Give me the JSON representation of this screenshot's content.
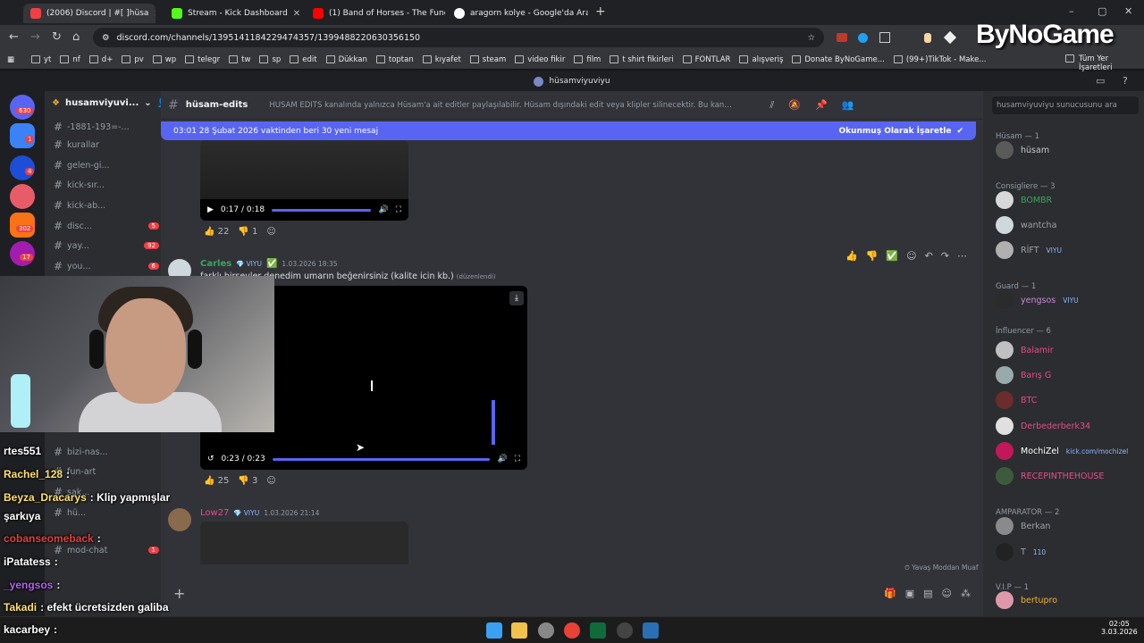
{
  "browser": {
    "tabs": [
      {
        "title": "(2006) Discord | #[ ]hüsa",
        "active": true,
        "color": "#f23f43"
      },
      {
        "title": "Stream - Kick Dashboard",
        "active": false,
        "color": "#53fc18"
      },
      {
        "title": "(1) Band of Horses - The Funer",
        "active": false,
        "color": "#ff0000"
      },
      {
        "title": "aragorn kolye - Google'da Ara",
        "active": false,
        "color": "#ffffff"
      }
    ],
    "url": "discord.com/channels/1395141184229474357/1399488220630356150",
    "bookmarks": [
      "yt",
      "nf",
      "d+",
      "pv",
      "wp",
      "telegr",
      "tw",
      "sp",
      "edit",
      "Dükkan",
      "toptan",
      "kıyafet",
      "steam",
      "video fikir",
      "film",
      "t shirt fikirleri",
      "FONTLAR",
      "alışveriş",
      "Donate ByNoGame...",
      "(99+)TikTok - Make..."
    ],
    "bookmarks_right": "Tüm Yer İşaretleri"
  },
  "logo": "ByNoGame",
  "discord": {
    "window_title": "hüsamviyuviyu",
    "server_name": "husamviyuvi...",
    "guild_badges": [
      "630",
      "1",
      "4",
      "302",
      "17"
    ],
    "channels": [
      {
        "name": "-1881-193=-...",
        "badge": ""
      },
      {
        "name": "kurallar",
        "badge": ""
      },
      {
        "name": "gelen-gi...",
        "badge": ""
      },
      {
        "name": "kick-sır...",
        "badge": ""
      },
      {
        "name": "kick-ab...",
        "badge": ""
      },
      {
        "name": "disc...",
        "badge": "5"
      },
      {
        "name": "yay...",
        "badge": "92"
      },
      {
        "name": "you...",
        "badge": "6"
      },
      {
        "name": "bizi-nas...",
        "badge": ""
      },
      {
        "name": "fun-art",
        "badge": ""
      },
      {
        "name": "sak...",
        "badge": ""
      },
      {
        "name": "hü...",
        "badge": ""
      },
      {
        "name": "mod-chat",
        "badge": "1"
      }
    ],
    "channel_header": {
      "name": "hüsam-edits",
      "topic": "HÜSAM EDİTS kanalında yalnızca Hüsam'a ait editler paylaşılabilir. Hüsam dışındaki edit veya klipler silinecektir. Bu kanalda paylaşılan içeriklerin kişiye ait olması zorunl...",
      "search_placeholder": "husamviyuviyu sunucusunu ara"
    },
    "banner": {
      "text": "03:01 28 Şubat 2026 vaktinden beri 30 yeni mesaj",
      "action": "Okunmuş Olarak İşaretle"
    },
    "messages": [
      {
        "video_time": "0:17 / 0:18",
        "likes": "22",
        "dislikes": "1"
      },
      {
        "author": "Carles",
        "tag": "VIYU",
        "timestamp": "1.03.2026 18:35",
        "text": "farklı birşeyler denedim umarın beğenirsiniz (kalite icin kb.)",
        "edited": "(düzenlendi)",
        "video_time": "0:23 / 0:23",
        "likes": "25",
        "dislikes": "3"
      },
      {
        "author": "Low27",
        "tag": "VIYU",
        "timestamp": "1.03.2026 21:14"
      }
    ],
    "slowmode": "Yavaş Moddan Muaf",
    "members": {
      "roles": [
        {
          "role": "Hüsam — 1",
          "color": "#949ba4",
          "members": [
            {
              "name": "hüsam",
              "color": "#c9c9c9",
              "tag": ""
            }
          ]
        },
        {
          "role": "Consigliere — 3",
          "color": "#949ba4",
          "members": [
            {
              "name": "BOMBR",
              "color": "#3ba55d",
              "tag": ""
            },
            {
              "name": "wantcha",
              "color": "#a0a0a0",
              "tag": ""
            },
            {
              "name": "RİFT",
              "color": "#a0a0a0",
              "tag": "VIYU"
            }
          ]
        },
        {
          "role": "Guard — 1",
          "color": "#949ba4",
          "members": [
            {
              "name": "yengsos",
              "color": "#c98ad8",
              "tag": "VIYU"
            }
          ]
        },
        {
          "role": "İnfluencer — 6",
          "color": "#949ba4",
          "members": [
            {
              "name": "Balamir",
              "color": "#e84b8a",
              "tag": ""
            },
            {
              "name": "Barış G",
              "color": "#e84b8a",
              "tag": ""
            },
            {
              "name": "BTC",
              "color": "#e84b8a",
              "tag": ""
            },
            {
              "name": "Derbederberk34",
              "color": "#e84b8a",
              "tag": ""
            },
            {
              "name": "MochiZel",
              "color": "#ffffff",
              "tag": "kick.com/mochizel"
            },
            {
              "name": "RECEPINTHEHOUSE",
              "color": "#e84b8a",
              "tag": ""
            }
          ]
        },
        {
          "role": "AMPARATOR — 2",
          "color": "#949ba4",
          "members": [
            {
              "name": "Berkan",
              "color": "#a0a0a0",
              "tag": ""
            },
            {
              "name": "T",
              "color": "#a0a0a0",
              "tag": "110"
            }
          ]
        },
        {
          "role": "V.I.P — 1",
          "color": "#949ba4",
          "members": [
            {
              "name": "bertupro",
              "color": "#f0b232",
              "tag": ""
            }
          ]
        }
      ]
    }
  },
  "stream_chat": [
    {
      "user": "rtes551",
      "msg": "",
      "color": "#ffffff"
    },
    {
      "user": "Rachel_128",
      "msg": ":",
      "color": "#ffe16b"
    },
    {
      "user": "Beyza_Dracarys",
      "msg": ": Klip yapmışlar",
      "color": "#ffe16b"
    },
    {
      "user": "şarkıya",
      "msg": "",
      "color": "#ffffff"
    },
    {
      "user": "cobanseomeback",
      "msg": ":",
      "color": "#e0413c"
    },
    {
      "user": "iPatatess",
      "msg": ":",
      "color": "#ffffff"
    },
    {
      "user": "_yengsos",
      "msg": ":",
      "color": "#b062f0"
    },
    {
      "user": "Takadi",
      "msg": ": efekt ücretsizden galiba",
      "color": "#ffe16b"
    },
    {
      "user": "kacarbey",
      "msg": ":",
      "color": "#ffffff"
    }
  ],
  "taskbar": {
    "time": "02:05",
    "date": "3.03.2026"
  }
}
